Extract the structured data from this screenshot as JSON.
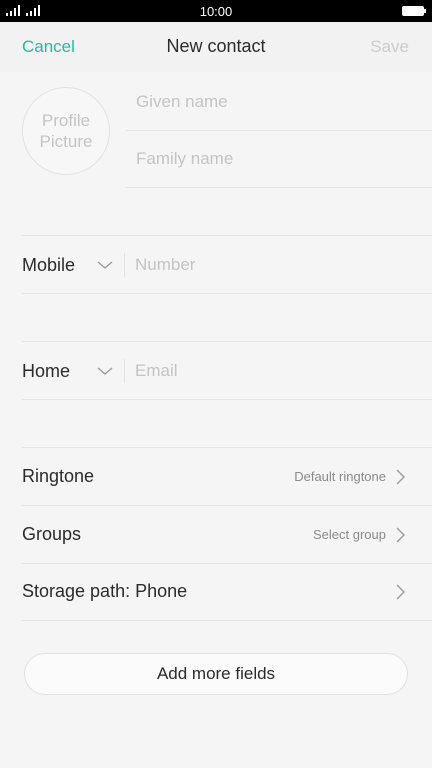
{
  "status_bar": {
    "time": "10:00",
    "signal_icon": "signal-icon",
    "battery_icon": "battery-icon"
  },
  "header": {
    "cancel_label": "Cancel",
    "title": "New contact",
    "save_label": "Save",
    "accent_color": "#2db7a3",
    "save_disabled_color": "#cccccc"
  },
  "profile": {
    "picture_label_line1": "Profile",
    "picture_label_line2": "Picture",
    "given_name_placeholder": "Given name",
    "family_name_placeholder": "Family name"
  },
  "phone": {
    "type": "Mobile",
    "placeholder": "Number",
    "dropdown_icon": "chevron-down-icon"
  },
  "email": {
    "type": "Home",
    "placeholder": "Email",
    "dropdown_icon": "chevron-down-icon"
  },
  "settings": [
    {
      "label": "Ringtone",
      "value": "Default ringtone",
      "icon": "chevron-right-icon"
    },
    {
      "label": "Groups",
      "value": "Select group",
      "icon": "chevron-right-icon"
    },
    {
      "label": "Storage path: Phone",
      "value": "",
      "icon": "chevron-right-icon"
    }
  ],
  "add_more_fields_label": "Add more fields"
}
